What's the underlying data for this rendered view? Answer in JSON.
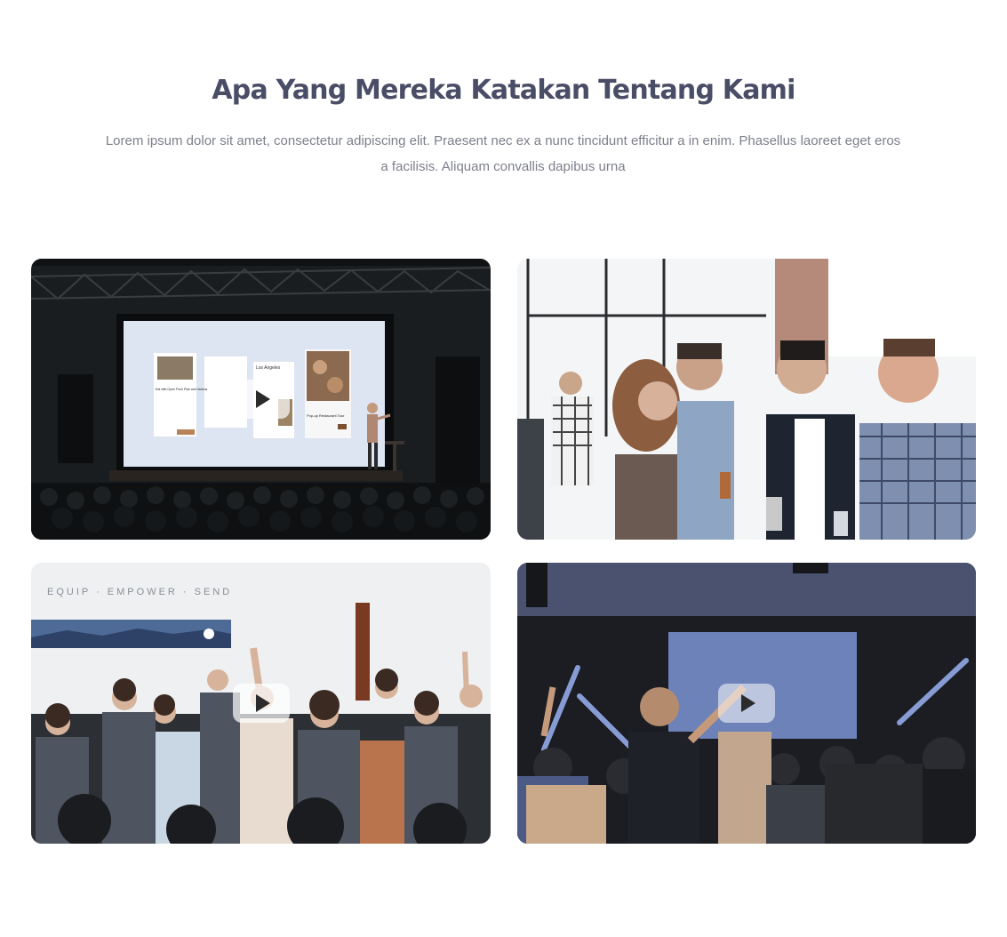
{
  "section": {
    "title": "Apa Yang Mereka Katakan Tentang Kami",
    "subtitle": "Lorem ipsum dolor sit amet, consectetur adipiscing elit. Praesent nec ex a nunc tincidunt efficitur a in enim. Phasellus laoreet eget eros a facilisis. Aliquam convallis dapibus urna"
  },
  "videos": [
    {
      "scene": "conference-stage-presentation",
      "play_icon": "play-icon"
    },
    {
      "scene": "networking-group-conversation",
      "play_icon": "none"
    },
    {
      "scene": "audience-raising-hands",
      "play_icon": "play-icon"
    },
    {
      "scene": "concert-crowd-screen",
      "play_icon": "play-icon"
    }
  ],
  "slide_text": {
    "wall_banner": "EQUIP · EMPOWER · SEND",
    "screen_heading": "Los Angeles",
    "screen_card": "Eat with Open Floor Plan and Various",
    "screen_right": "Pop-up Restaurant Tour"
  },
  "colors": {
    "title": "#4a4d66",
    "subtitle": "#7d7f8c",
    "background": "#ffffff"
  }
}
